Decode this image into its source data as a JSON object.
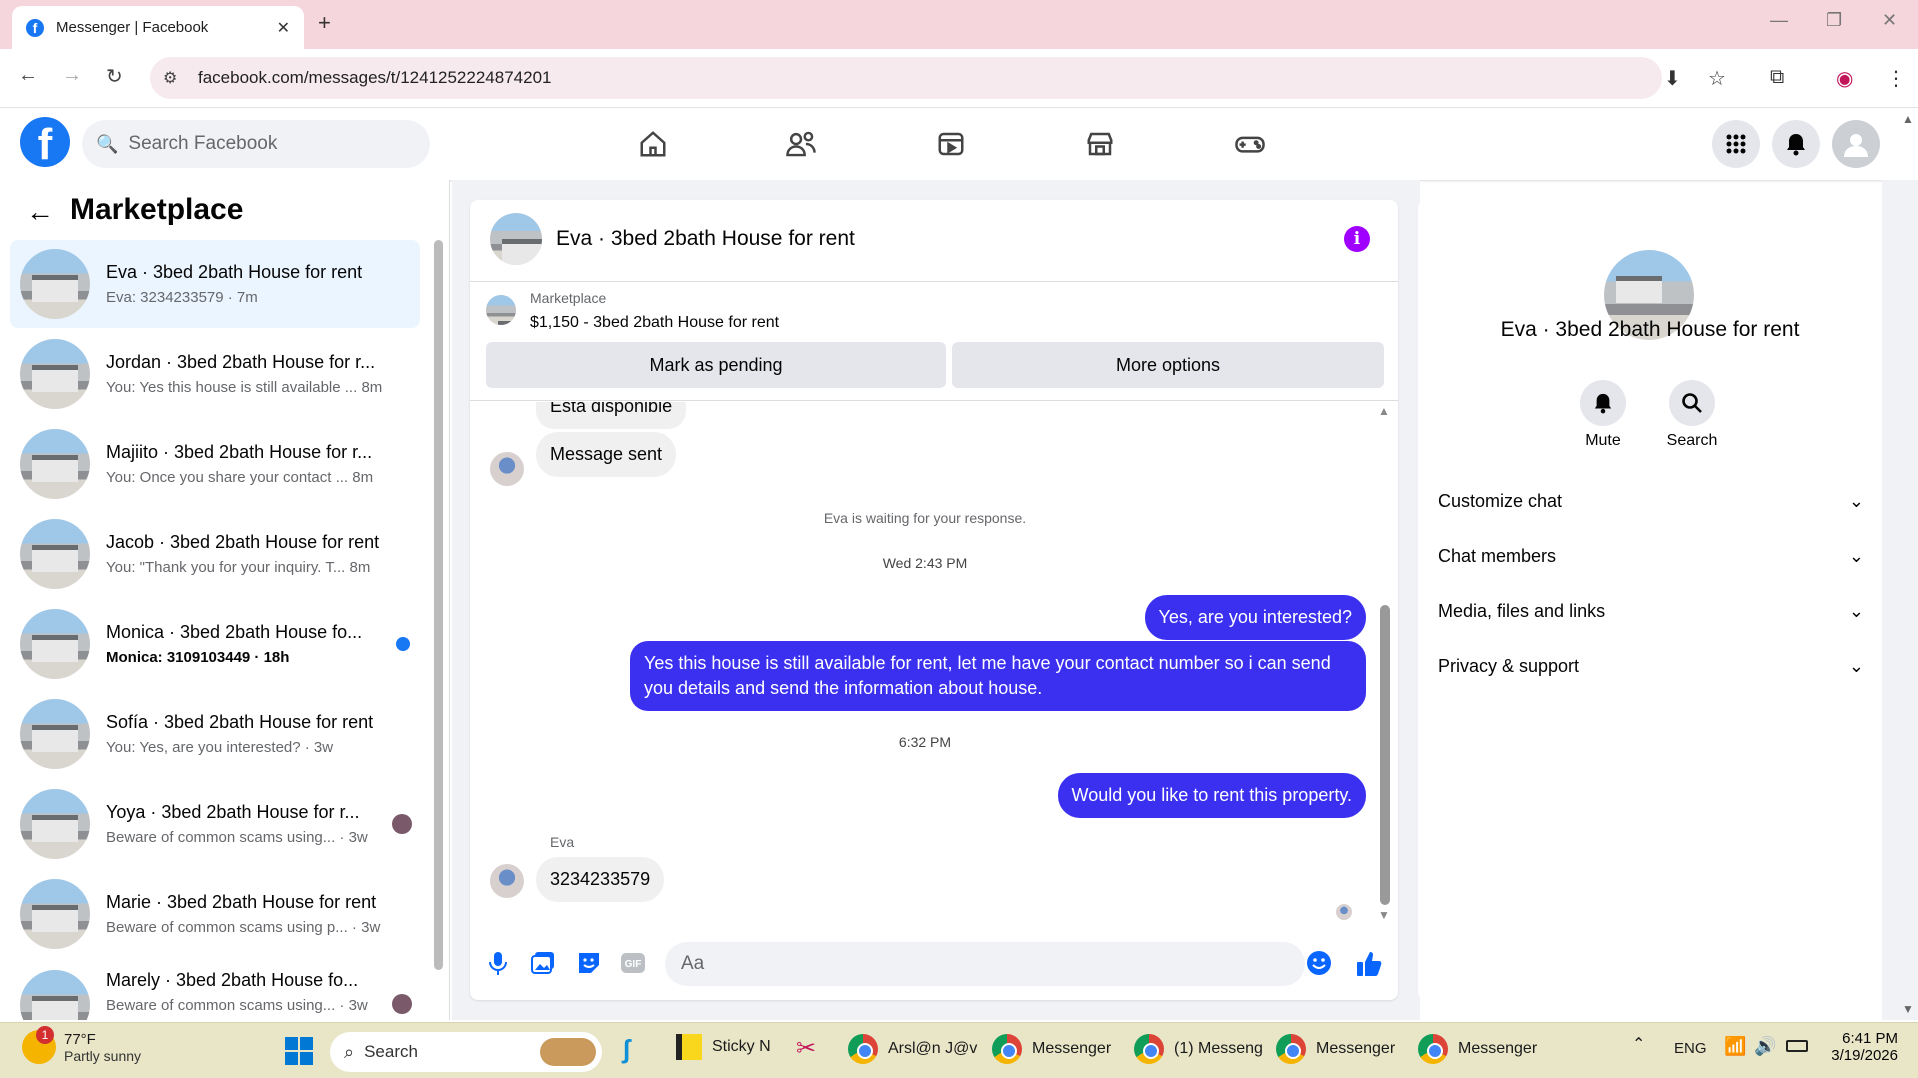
{
  "browser": {
    "tab_title": "Messenger | Facebook",
    "url": "facebook.com/messages/t/1241252224874201"
  },
  "header": {
    "search_placeholder": "Search Facebook"
  },
  "left": {
    "title": "Marketplace",
    "conversations": [
      {
        "name": "Eva · 3bed 2bath House for rent",
        "sub": "Eva: 3234233579 · 7m",
        "active": true
      },
      {
        "name": "Jordan · 3bed 2bath House for r...",
        "sub": "You: Yes this house is still available ... 8m"
      },
      {
        "name": "Majiito · 3bed 2bath House for r...",
        "sub": "You: Once you share your contact ... 8m"
      },
      {
        "name": "Jacob · 3bed 2bath House for rent",
        "sub": "You: \"Thank you for your inquiry. T... 8m"
      },
      {
        "name": "Monica · 3bed 2bath House fo...",
        "sub": "Monica: 3109103449 · 18h",
        "unread": true
      },
      {
        "name": "Sofía · 3bed 2bath House for rent",
        "sub": "You: Yes, are you interested? · 3w"
      },
      {
        "name": "Yoya · 3bed 2bath House for r...",
        "sub": "Beware of common scams using... · 3w",
        "seen": true
      },
      {
        "name": "Marie · 3bed 2bath House for rent",
        "sub": "Beware of common scams using p... · 3w"
      },
      {
        "name": "Marely · 3bed 2bath House fo...",
        "sub": "Beware of common scams using... · 3w",
        "seen": true
      }
    ]
  },
  "chat": {
    "title": "Eva · 3bed 2bath House for rent",
    "marketplace_label": "Marketplace",
    "listing": "$1,150 - 3bed 2bath House for rent",
    "btn_pending": "Mark as pending",
    "btn_more": "More options",
    "msg_partial": "Está disponible",
    "msg_sent": "Message sent",
    "waiting": "Eva is waiting for your response.",
    "time1": "Wed 2:43 PM",
    "out1": "Yes, are you interested?",
    "out2": "Yes this house is still available for rent, let me have your contact number so i can send you details and send the information about house.",
    "time2": "6:32 PM",
    "out3": "Would you like to rent this property.",
    "sender": "Eva",
    "in_last": "3234233579",
    "compose_placeholder": "Aa"
  },
  "right": {
    "name": "Eva · 3bed 2bath House for rent",
    "mute": "Mute",
    "search": "Search",
    "sections": [
      "Customize chat",
      "Chat members",
      "Media, files and links",
      "Privacy & support"
    ]
  },
  "taskbar": {
    "temp": "77°F",
    "weather": "Partly sunny",
    "weather_badge": "1",
    "search": "Search",
    "sticky": "Sticky N",
    "items": [
      "Arsl@n J@v",
      "Messenger",
      "(1) Messeng",
      "Messenger",
      "Messenger"
    ],
    "lang": "ENG",
    "time": "6:41 PM",
    "date": "3/19/2026"
  }
}
